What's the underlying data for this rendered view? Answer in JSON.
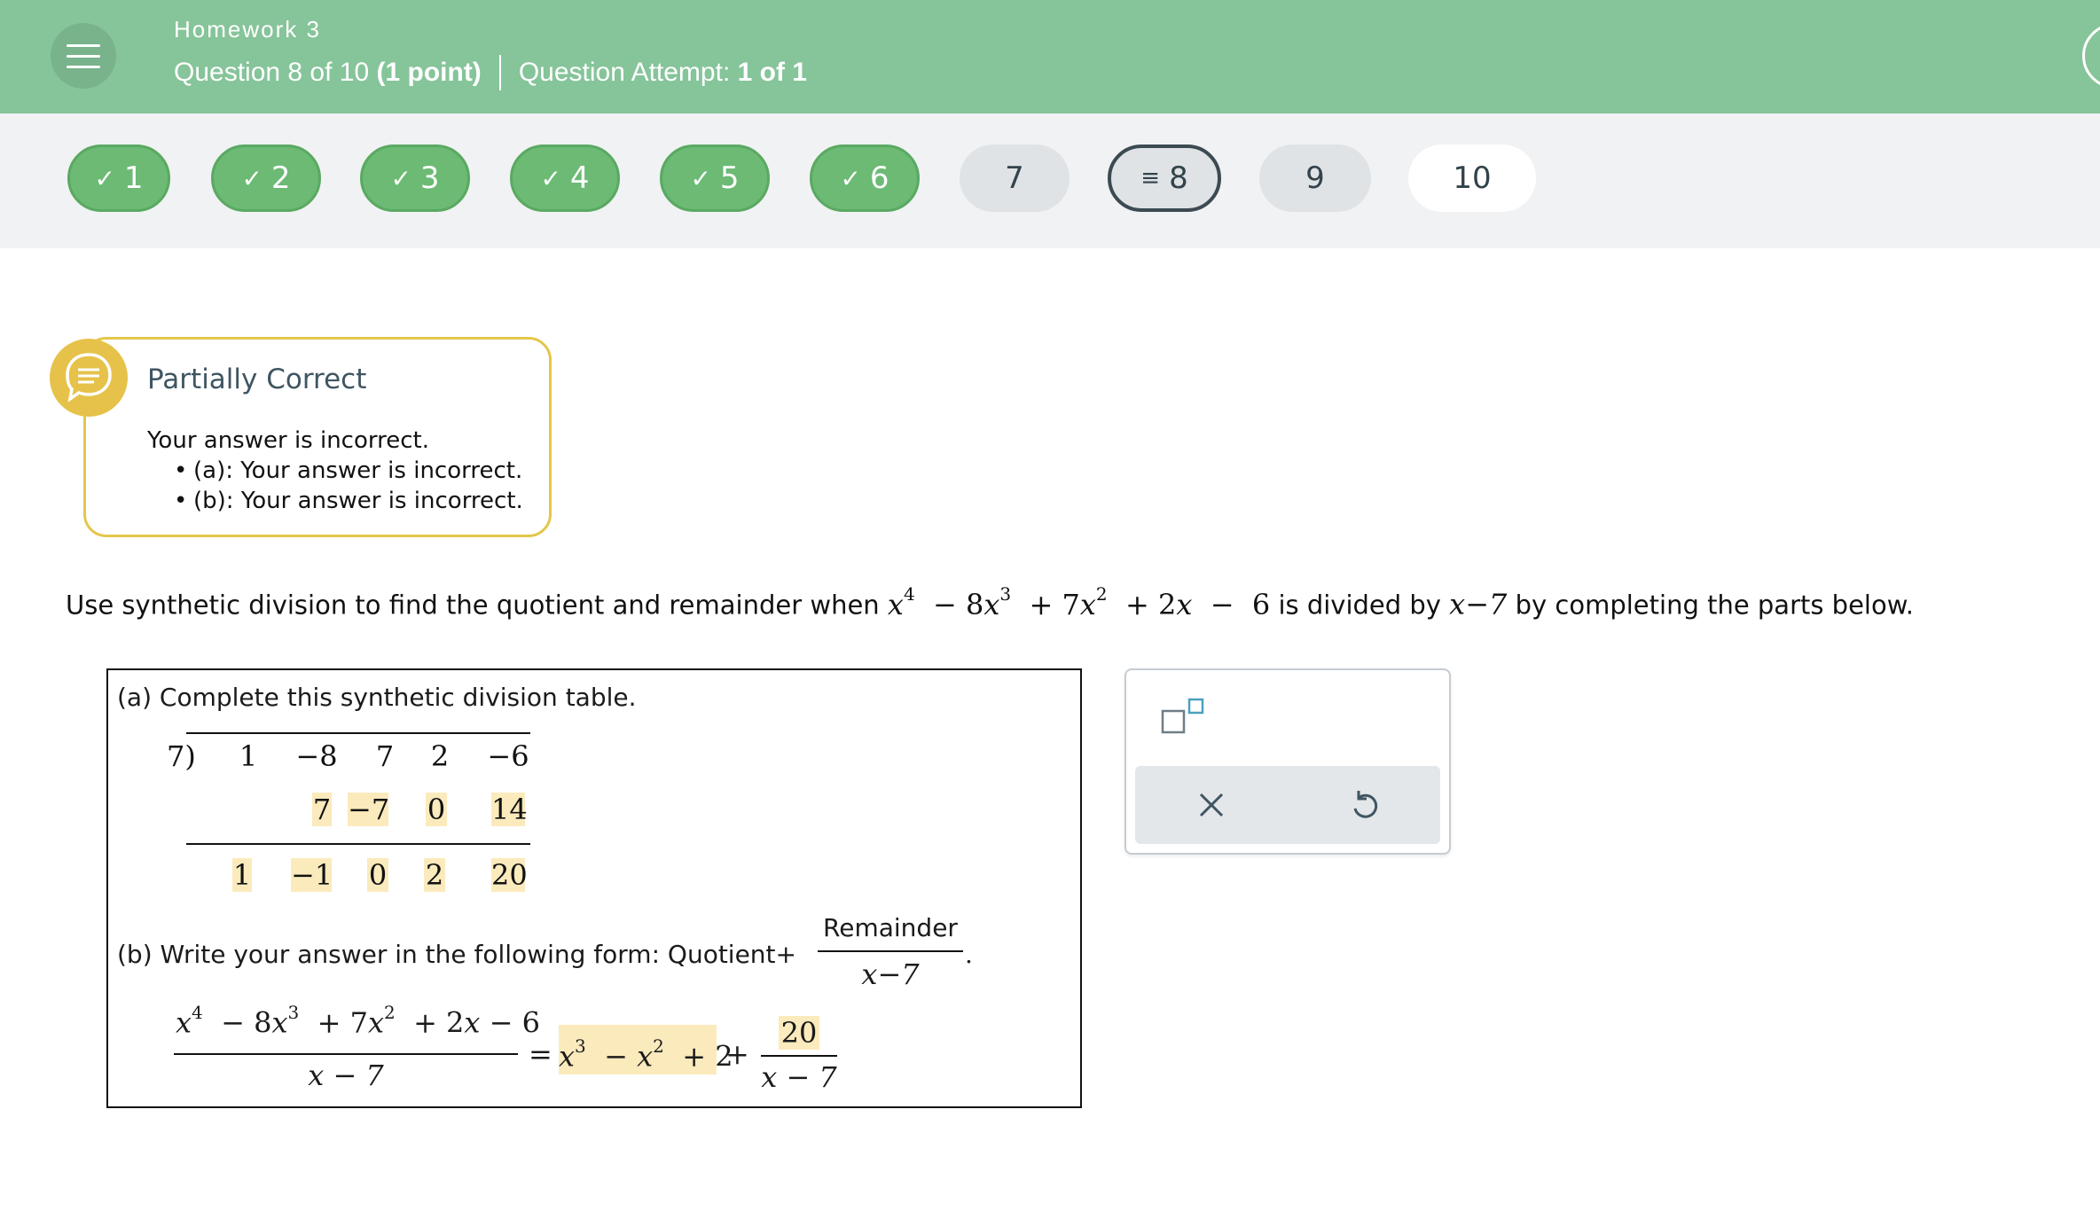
{
  "header": {
    "assignment": "Homework 3",
    "question_of": "Question 8 of 10",
    "points": "(1 point)",
    "attempt_label": "Question Attempt:",
    "attempt_value": "1 of 1",
    "accent": "#86c49a"
  },
  "question_nav": [
    {
      "label": "1",
      "status": "done"
    },
    {
      "label": "2",
      "status": "done"
    },
    {
      "label": "3",
      "status": "done"
    },
    {
      "label": "4",
      "status": "done"
    },
    {
      "label": "5",
      "status": "done"
    },
    {
      "label": "6",
      "status": "done"
    },
    {
      "label": "7",
      "status": "todo"
    },
    {
      "label": "8",
      "status": "current"
    },
    {
      "label": "9",
      "status": "todo"
    },
    {
      "label": "10",
      "status": "blank"
    }
  ],
  "feedback": {
    "title": "Partially Correct",
    "message": "Your answer is incorrect.",
    "items": [
      "(a): Your answer is incorrect.",
      "(b): Your answer is incorrect."
    ],
    "color": "#e4c64a"
  },
  "statement": {
    "prefix": "Use synthetic division to find the quotient and remainder when",
    "middle": "is divided by",
    "divisor": "x−7",
    "suffix": "by completing the parts below."
  },
  "part_a": {
    "label": "(a)  Complete this synthetic division table.",
    "divisor": "7)",
    "coefficients": [
      "1",
      "−8",
      "7",
      "2",
      "−6"
    ],
    "middle_row": [
      "7",
      "−7",
      "0",
      "14"
    ],
    "bottom_row": [
      "1",
      "−1",
      "0",
      "2",
      "20"
    ]
  },
  "part_b": {
    "label": "(b)  Write your answer in the following form: Quotient+",
    "form_numerator": "Remainder",
    "form_denominator": "x−7",
    "lhs_denominator": "x − 7",
    "remainder_numerator": "20",
    "remainder_denominator": "x − 7"
  },
  "tools": {
    "superscript_icon": "superscript-icon",
    "clear_icon": "close-icon",
    "undo_icon": "undo-icon"
  }
}
